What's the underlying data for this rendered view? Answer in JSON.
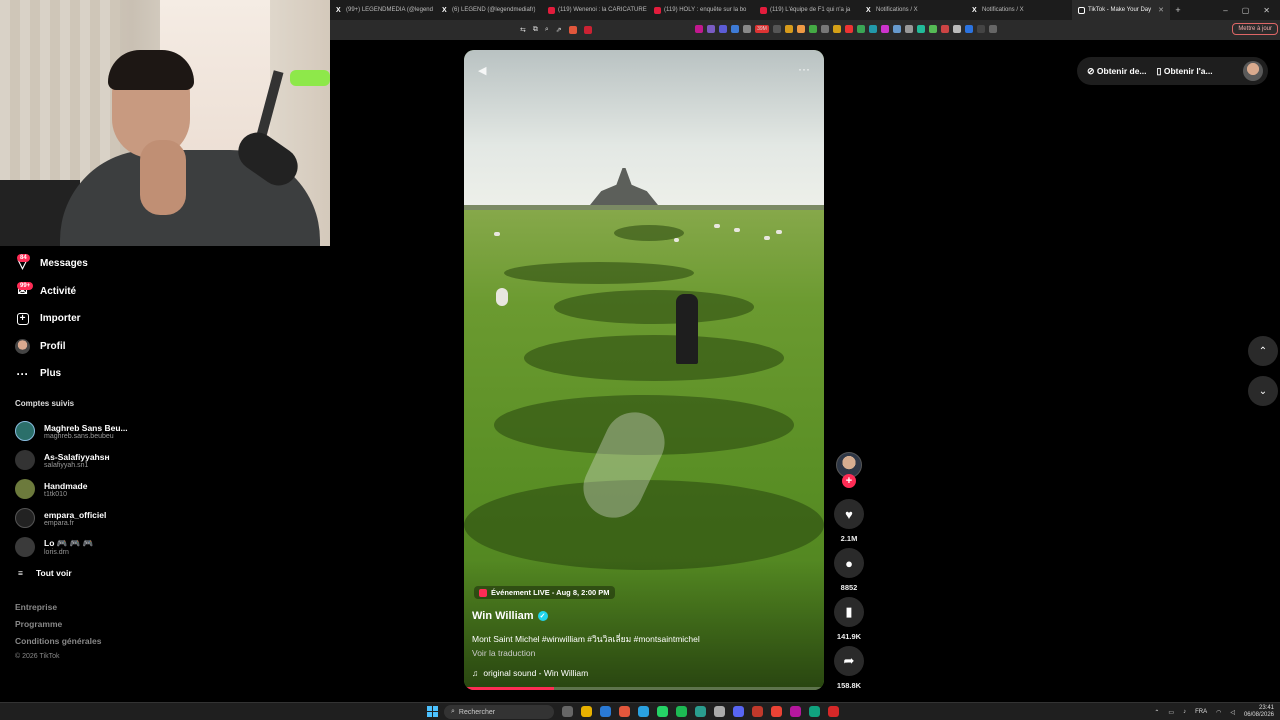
{
  "browser": {
    "tabs": [
      {
        "label": "(99+) LEGENDMEDIA (@legend",
        "icon": "x-icon"
      },
      {
        "label": "(6) LEGEND (@legendmediafr)",
        "icon": "x-icon"
      },
      {
        "label": "(119) Wenenoi : la CARICATURE",
        "icon": "youtube-icon"
      },
      {
        "label": "(119) HOLY : enquête sur la bo",
        "icon": "youtube-icon"
      },
      {
        "label": "(119) L'équipe de F1 qui n'a ja",
        "icon": "youtube-icon"
      },
      {
        "label": "Notifications / X",
        "icon": "x-icon"
      },
      {
        "label": "Notifications / X",
        "icon": "x-icon"
      },
      {
        "label": "TikTok - Make Your Day",
        "icon": "tiktok-icon",
        "active": true
      }
    ],
    "new_tab": "+",
    "window_controls": [
      "–",
      "▢",
      "✕"
    ],
    "update_button": "Mettre à jour",
    "badge_count": "39M"
  },
  "sidebar": {
    "items": [
      {
        "label": "Messages",
        "badge": "84",
        "icon": "paper-plane-icon"
      },
      {
        "label": "Activité",
        "badge": "99+",
        "icon": "inbox-icon"
      },
      {
        "label": "Importer",
        "icon": "upload-plus-icon"
      },
      {
        "label": "Profil",
        "icon": "avatar-icon"
      },
      {
        "label": "Plus",
        "icon": "more-dots-icon"
      }
    ],
    "following_title": "Comptes suivis",
    "following": [
      {
        "name": "Maghreb Sans Beu...",
        "handle": "maghreb.sans.beubeu",
        "color": "#2b6f6a"
      },
      {
        "name": "As-Salafiyyahsн",
        "handle": "salafiyyah.sn1",
        "color": "#333333"
      },
      {
        "name": "Handmade",
        "handle": "t1tk010",
        "color": "#6c7a3c"
      },
      {
        "name": "empara_officiel",
        "handle": "empara.fr",
        "color": "#222222"
      },
      {
        "name": "Lo 🎮 🎮 🎮",
        "handle": "loris.drn",
        "color": "#3a3a3a"
      }
    ],
    "see_all": "Tout voir",
    "footer_links": [
      "Entreprise",
      "Programme",
      "Conditions générales"
    ],
    "copyright": "© 2026 TikTok"
  },
  "video": {
    "live_event": "Événement LIVE - Aug 8, 2:00 PM",
    "author": "Win William",
    "caption": "Mont Saint Michel #winwilliam #วินวิลเลี่ยม #montsaintmichel",
    "translate": "Voir la traduction",
    "sound": "original sound - Win William",
    "progress": 0.25
  },
  "actions": {
    "likes": "2.1M",
    "comments": "8852",
    "saves": "141.9K",
    "shares": "158.8K"
  },
  "top_right": {
    "get_desktop": "Obtenir de...",
    "get_app": "Obtenir l'a..."
  },
  "taskbar": {
    "search": "Rechercher",
    "lang": "FRA",
    "time": "23:41",
    "date": "06/08/2026"
  }
}
